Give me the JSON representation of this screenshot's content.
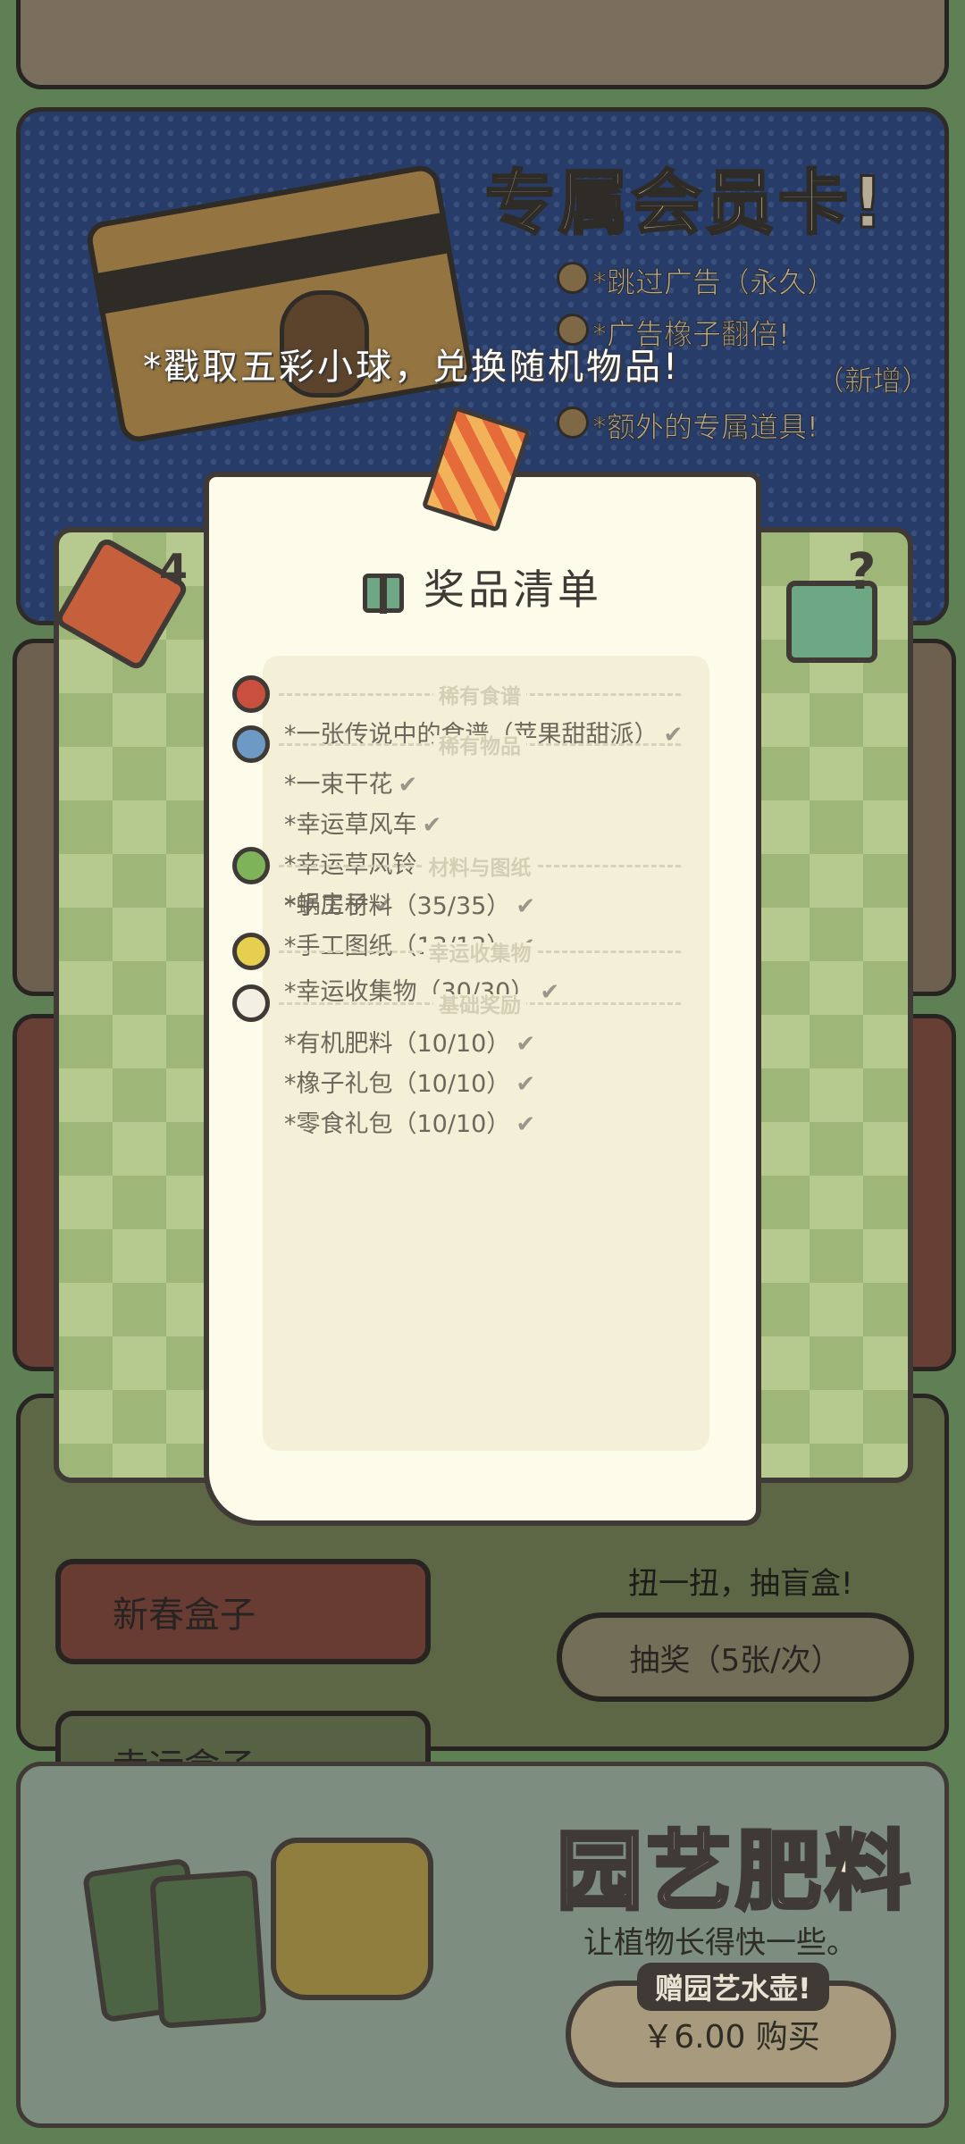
{
  "member": {
    "title": "专属会员卡!",
    "perks": [
      "*跳过广告（永久）",
      "*广告橡子翻倍!",
      "（新增）",
      "*额外的专属道具!"
    ],
    "caption": "*戳取五彩小球，兑换随机物品!"
  },
  "lottery": {
    "ticket_count": "4",
    "subtitle": "扭一扭，抽盲盒!",
    "draw_button": "抽奖（5张/次）",
    "tabs": [
      "新春盒子",
      "幸运盒子"
    ]
  },
  "prize_list": {
    "title": "奖品清单",
    "tiers": [
      {
        "name": "稀有食谱",
        "ball_color": "#c9503e",
        "items": [
          "*一张传说中的食谱（苹果甜甜派）"
        ]
      },
      {
        "name": "稀有物品",
        "ball_color": "#6d9ac4",
        "items": [
          "*一束干花",
          "*幸运草风车",
          "*幸运草风铃",
          "*蜗房子"
        ]
      },
      {
        "name": "材料与图纸",
        "ball_color": "#7fb35a",
        "items": [
          "*手工材料（35/35）",
          "*手工图纸（13/13）"
        ]
      },
      {
        "name": "幸运收集物",
        "ball_color": "#e6cf4f",
        "items": [
          "*幸运收集物（30/30）"
        ]
      },
      {
        "name": "基础奖励",
        "ball_color": "#f3efe2",
        "items": [
          "*有机肥料（10/10）",
          "*橡子礼包（10/10）",
          "*零食礼包（10/10）"
        ]
      }
    ],
    "check_glyph": "✔"
  },
  "fertilizer": {
    "title": "园艺肥料",
    "subtitle": "让植物长得快一些。",
    "gift_badge": "赠园艺水壶!",
    "buy_button": "￥6.00 购买"
  }
}
